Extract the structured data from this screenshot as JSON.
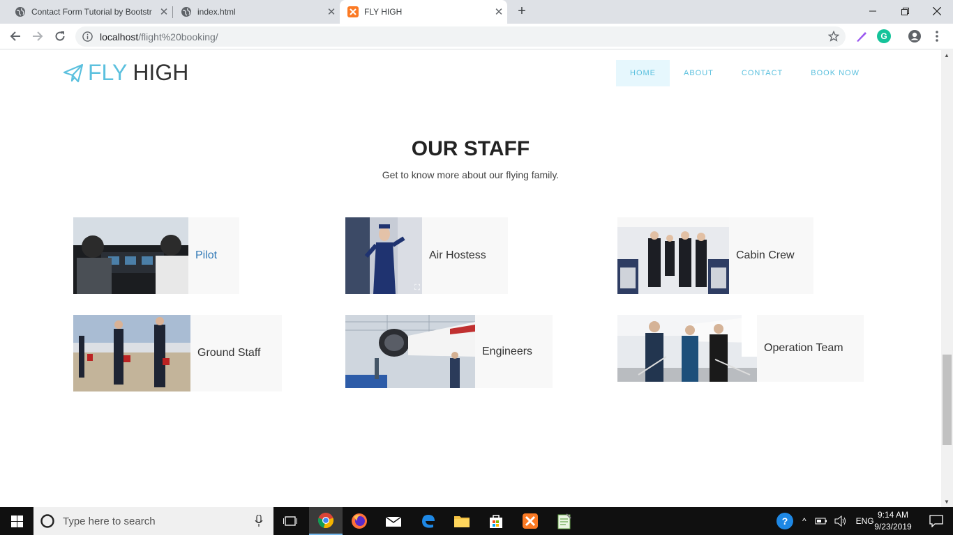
{
  "browser": {
    "tabs": [
      {
        "title": "Contact Form Tutorial by Bootstr",
        "active": false
      },
      {
        "title": "index.html",
        "active": false
      },
      {
        "title": "FLY HIGH",
        "active": true
      }
    ],
    "url_host": "localhost",
    "url_path": "/flight%20booking/"
  },
  "site": {
    "brand_fly": "FLY",
    "brand_high": "HIGH",
    "nav": [
      {
        "label": "HOME",
        "active": true
      },
      {
        "label": "ABOUT",
        "active": false
      },
      {
        "label": "CONTACT",
        "active": false
      },
      {
        "label": "BOOK NOW",
        "active": false
      }
    ]
  },
  "staff": {
    "title": "OUR STAFF",
    "subtitle": "Get to know more about our flying family.",
    "cards": [
      {
        "label": "Pilot",
        "photo": "pilot-cockpit-photo",
        "link": true
      },
      {
        "label": "Air Hostess",
        "photo": "air-hostess-photo",
        "link": false
      },
      {
        "label": "Cabin Crew",
        "photo": "cabin-crew-photo",
        "link": false
      },
      {
        "label": "Ground Staff",
        "photo": "ground-staff-photo",
        "link": false
      },
      {
        "label": "Engineers",
        "photo": "engineers-hangar-photo",
        "link": false
      },
      {
        "label": "Operation Team",
        "photo": "operation-team-photo",
        "link": false
      }
    ]
  },
  "taskbar": {
    "search_placeholder": "Type here to search",
    "language": "ENG",
    "time": "9:14 AM",
    "date": "9/23/2019"
  },
  "colors": {
    "accent": "#5bc0de",
    "link": "#337ab7",
    "nav_active_bg": "#e6f7fd",
    "card_bg": "#f8f8f8"
  }
}
